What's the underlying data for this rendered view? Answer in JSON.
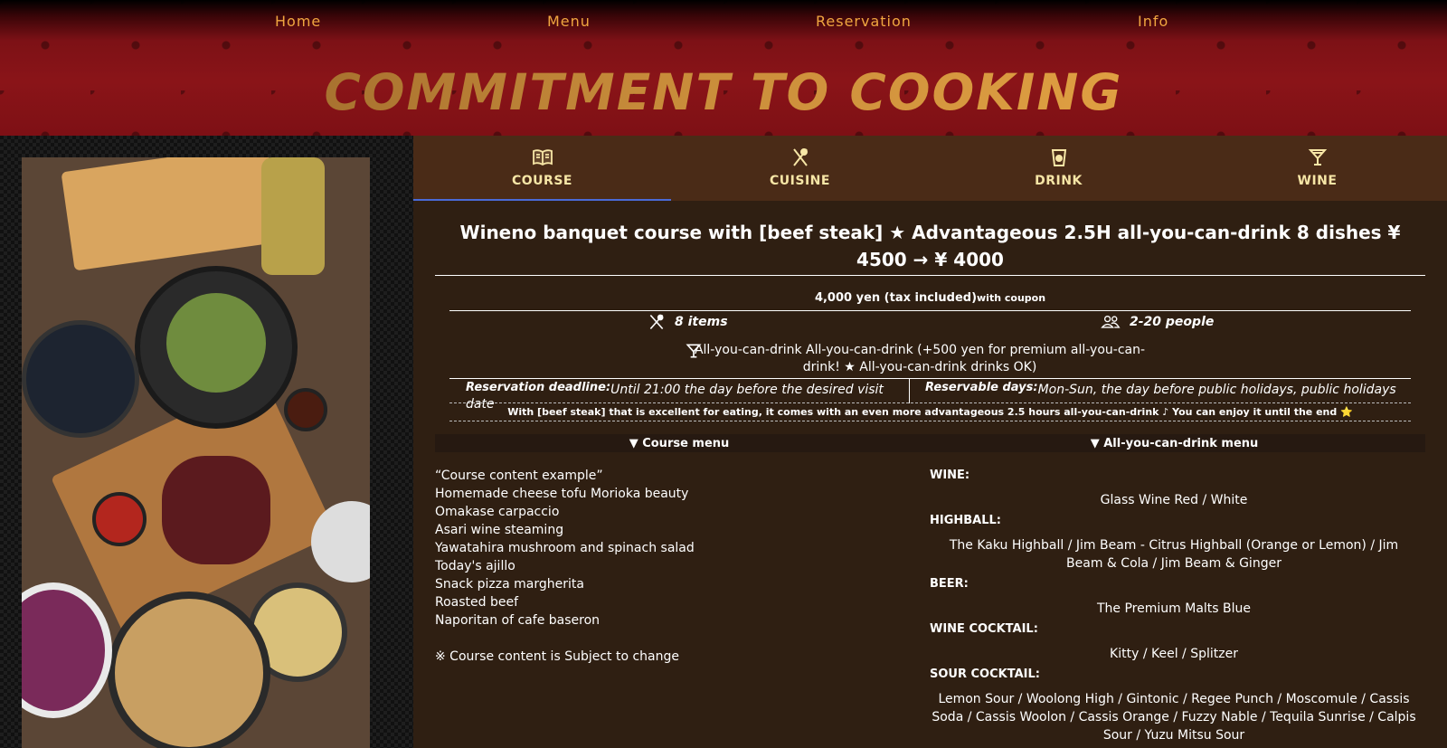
{
  "nav": {
    "items": [
      "Home",
      "Menu",
      "Reservation",
      "Info"
    ]
  },
  "hero": {
    "title": "COMMITMENT TO COOKING"
  },
  "tabs": [
    {
      "label": "COURSE",
      "icon": "menu-book-icon"
    },
    {
      "label": "CUISINE",
      "icon": "fork-knife-icon"
    },
    {
      "label": "DRINK",
      "icon": "cup-icon"
    },
    {
      "label": "WINE",
      "icon": "cocktail-glass-icon"
    }
  ],
  "course": {
    "title": "Wineno banquet course with [beef steak] ★ Advantageous 2.5H all-you-can-drink 8 dishes ¥ 4500 → ¥ 4000",
    "price": "4,000 yen (tax included)",
    "price_note": "with coupon",
    "items_count": "8 items",
    "people": "2-20 people",
    "drink_info": "All-you-can-drink All-you-can-drink (+500 yen for premium all-you-can-drink! ★ All-you-can-drink drinks OK)",
    "deadline_label": "Reservation deadline:",
    "deadline_value": "Until 21:00 the day before the desired visit date",
    "days_label": "Reservable days:",
    "days_value": "Mon-Sun, the day before public holidays, public holidays",
    "note": "With [beef steak] that is excellent for eating, it comes with an even more advantageous 2.5 hours all-you-can-drink ♪ You can enjoy it until the end ⭐"
  },
  "sections": {
    "course_menu": "▼ Course menu",
    "drink_menu": "▼ All-you-can-drink menu"
  },
  "course_menu": {
    "items": [
      "“Course content example”",
      "Homemade cheese tofu Morioka beauty",
      "Omakase carpaccio",
      "Asari wine steaming",
      "Yawatahira mushroom and spinach salad",
      "Today's ajillo",
      "Snack pizza margherita",
      "Roasted beef",
      "Naporitan of cafe baseron"
    ],
    "change_note": "※ Course content is Subject to change"
  },
  "drink_menu": [
    {
      "category": "WINE:",
      "items": "Glass Wine Red / White"
    },
    {
      "category": "HIGHBALL:",
      "items": "The Kaku Highball / Jim Beam  -  Citrus Highball (Orange or Lemon) / Jim Beam & Cola / Jim Beam & Ginger"
    },
    {
      "category": "BEER:",
      "items": "The Premium Malts Blue"
    },
    {
      "category": "WINE COCKTAIL:",
      "items": "Kitty / Keel / Splitzer"
    },
    {
      "category": "SOUR COCKTAIL:",
      "items": "Lemon Sour / Woolong High / Gintonic / Regee Punch / Moscomule / Cassis Soda / Cassis Woolon / Cassis Orange / Fuzzy Nable / Tequila Sunrise / Calpis Sour / Yuzu Mitsu Sour"
    }
  ],
  "colors": {
    "nav_text": "#f0a640",
    "tab_label": "#f7e6a6",
    "active_tab_underline": "#4a6ad6",
    "background": "#2f1f12"
  }
}
